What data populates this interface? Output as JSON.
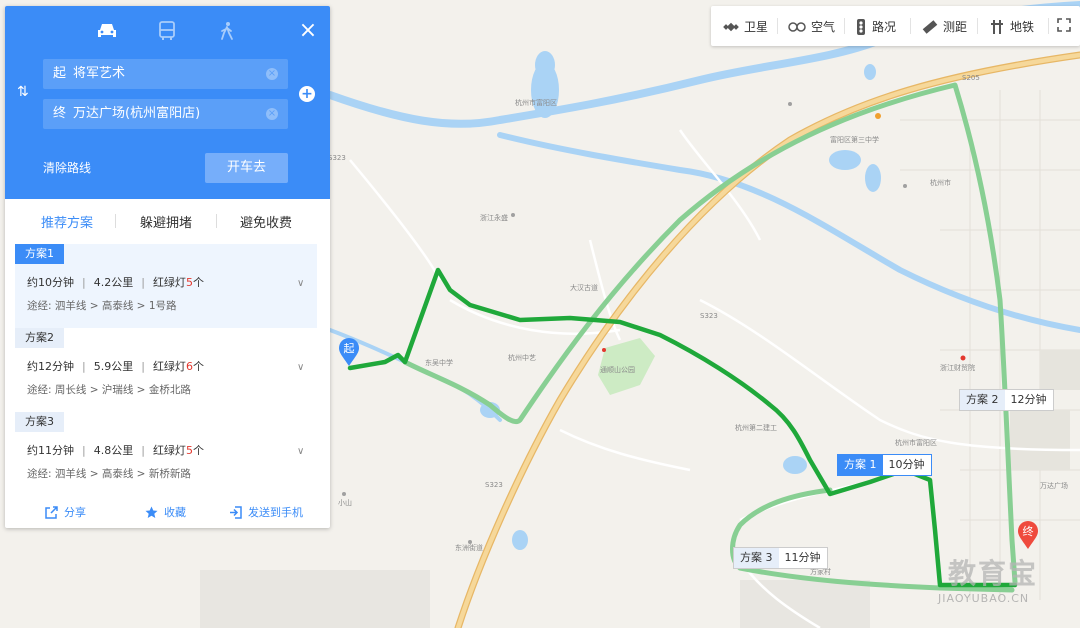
{
  "panel": {
    "origin_tag": "起",
    "origin": "将军艺术",
    "dest_tag": "终",
    "destination": "万达广场(杭州富阳店)",
    "clear_route": "清除路线",
    "go": "开车去",
    "tabs": [
      "推荐方案",
      "躲避拥堵",
      "避免收费"
    ],
    "plans": [
      {
        "badge": "方案1",
        "time": "约10分钟",
        "dist": "4.2公里",
        "lights_label": "红绿灯",
        "lights": "5",
        "lights_unit": "个",
        "via": "途经:  泗羊线 > 高泰线 > 1号路"
      },
      {
        "badge": "方案2",
        "time": "约12分钟",
        "dist": "5.9公里",
        "lights_label": "红绿灯",
        "lights": "6",
        "lights_unit": "个",
        "via": "途经:  周长线 > 沪瑞线 > 金桥北路"
      },
      {
        "badge": "方案3",
        "time": "约11分钟",
        "dist": "4.8公里",
        "lights_label": "红绿灯",
        "lights": "5",
        "lights_unit": "个",
        "via": "途经:  泗羊线 > 高泰线 > 新桥新路"
      }
    ],
    "footer": {
      "share": "分享",
      "favorite": "收藏",
      "send": "发送到手机"
    }
  },
  "toolbar": {
    "satellite": "卫星",
    "air": "空气",
    "traffic": "路况",
    "measure": "测距",
    "subway": "地铁"
  },
  "route_labels": {
    "plan1": {
      "key": "方案 1",
      "val": "10分钟"
    },
    "plan2": {
      "key": "方案 2",
      "val": "12分钟"
    },
    "plan3": {
      "key": "方案 3",
      "val": "11分钟"
    }
  },
  "markers": {
    "start": "起",
    "end": "终"
  },
  "map_labels": {
    "s1": "杭州市富阳区",
    "s2": "富阳区第三中学",
    "s3": "浙江永盛",
    "s4": "杭州中艺",
    "s5": "东吴中学",
    "s6": "杭州市",
    "s7": "浙江财贸院",
    "s8": "大汉古道",
    "s9": "通顺山公园",
    "s10": "杭州第二建工",
    "s11": "杭州市富阳区",
    "s12": "万达广场",
    "s13": "方家村",
    "s14": "东洲街道",
    "s15": "小山",
    "r1": "S323",
    "r2": "S323",
    "r3": "S323",
    "r4": "S205"
  },
  "watermark": {
    "line1": "教育宝",
    "line2": "JIAOYUBAO.CN"
  },
  "colors": {
    "accent": "#3b8cf7",
    "route_main": "#1fa83a",
    "route_alt": "#88cf93",
    "highway": "#f2c87a",
    "river": "#aad3f5",
    "red": "#e3372d"
  }
}
